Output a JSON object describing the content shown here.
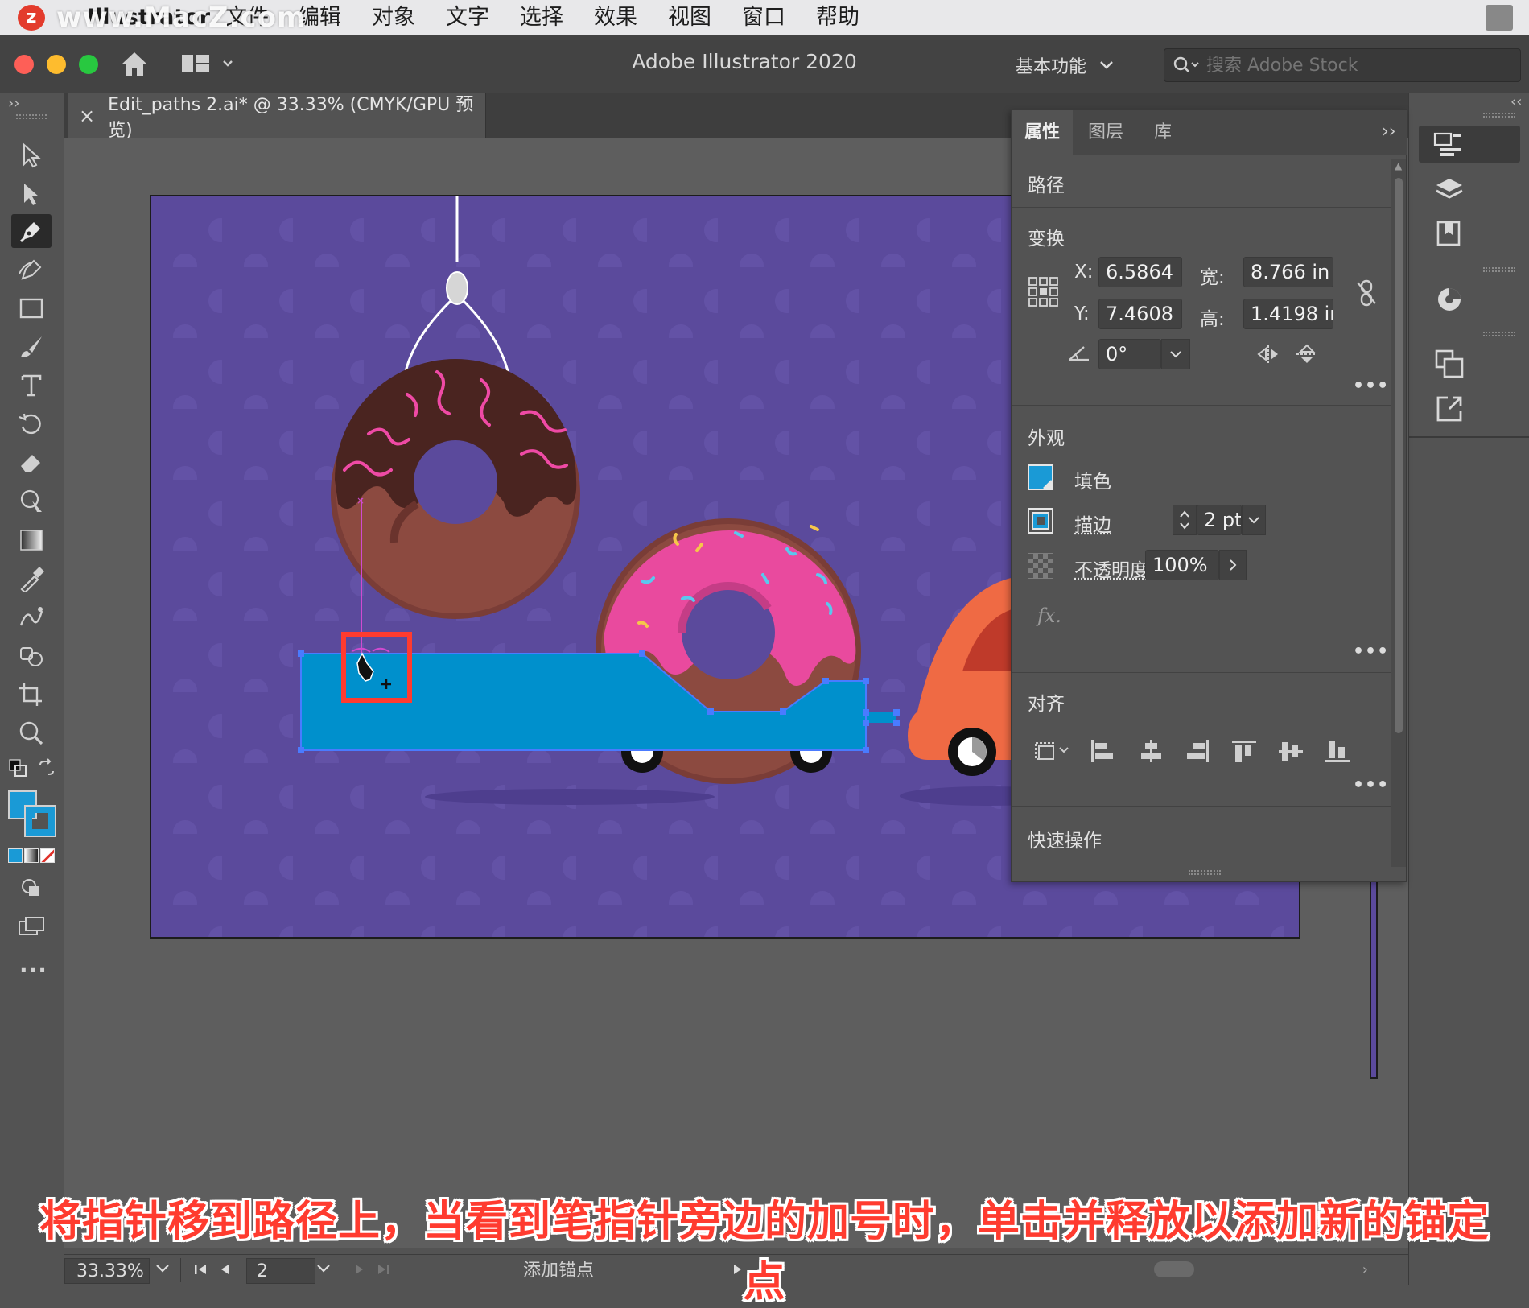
{
  "menubar": {
    "app_name": "Illustrator",
    "watermark": "www.MacZ.com",
    "items": [
      "文件",
      "编辑",
      "对象",
      "文字",
      "选择",
      "效果",
      "视图",
      "窗口",
      "帮助"
    ]
  },
  "titlebar": {
    "title": "Adobe Illustrator 2020",
    "workspace": "基本功能",
    "search_placeholder": "搜索 Adobe Stock"
  },
  "document": {
    "tab_label": "Edit_paths 2.ai* @ 33.33% (CMYK/GPU 预览)",
    "close": "×"
  },
  "properties_panel": {
    "tabs": [
      "属性",
      "图层",
      "库"
    ],
    "active_tab": "属性",
    "object_type": "路径",
    "transform": {
      "heading": "变换",
      "x_label": "X:",
      "x_value": "6.5864 i",
      "y_label": "Y:",
      "y_value": "7.4608 i",
      "w_label": "宽:",
      "w_value": "8.766 in",
      "h_label": "高:",
      "h_value": "1.4198 ir",
      "angle_value": "0°"
    },
    "appearance": {
      "heading": "外观",
      "fill_label": "填色",
      "stroke_label": "描边",
      "stroke_value": "2 pt",
      "opacity_label": "不透明度",
      "opacity_value": "100%",
      "fx_label": "fx."
    },
    "align": {
      "heading": "对齐"
    },
    "quick_actions": {
      "heading": "快速操作"
    }
  },
  "statusbar": {
    "zoom": "33.33%",
    "artboard_number": "2",
    "current_tool": "添加锚点"
  },
  "caption": "将指针移到路径上，当看到笔指针旁边的加号时，单击并释放以添加新的锚定点",
  "colors": {
    "artboard_bg": "#5b4a9c",
    "truck_blue": "#0090cc",
    "donut_pink": "#e94a9e",
    "chocolate": "#4a2420",
    "car_orange": "#ef6a44",
    "highlight_red": "#ff3b2f",
    "fill_swatch": "#1a9ad6"
  }
}
